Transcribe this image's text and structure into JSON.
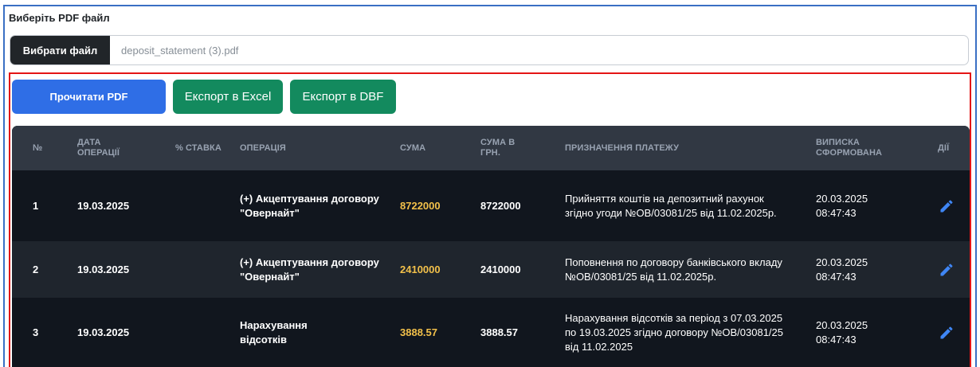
{
  "file_section": {
    "label": "Виберіть PDF файл",
    "choose_button": "Вибрати файл",
    "file_name": "deposit_statement (3).pdf"
  },
  "toolbar": {
    "read_pdf": "Прочитати PDF",
    "export_excel": "Експорт в Excel",
    "export_dbf": "Експорт в DBF"
  },
  "colors": {
    "primary": "#2f6ee6",
    "success": "#138a5e",
    "table_bg": "#11161e",
    "amount": "#f2c04a",
    "highlight_border": "#e41515"
  },
  "table": {
    "headers": {
      "num": "№",
      "date": "ДАТА ОПЕРАЦІЇ",
      "rate": "% СТАВКА",
      "operation": "ОПЕРАЦІЯ",
      "sum": "СУМА",
      "sum_uah": "СУМА В ГРН.",
      "purpose": "ПРИЗНАЧЕННЯ ПЛАТЕЖУ",
      "statement": "ВИПИСКА СФОРМОВАНА",
      "actions": "ДІЇ"
    },
    "rows": [
      {
        "num": "1",
        "date": "19.03.2025",
        "rate": "",
        "operation": "(+) Акцептування договору \"Овернайт\"",
        "sum": "8722000",
        "sum_uah": "8722000",
        "purpose": "Прийняття коштів на депозитний рахунок згідно угоди №OB/03081/25 від 11.02.2025р.",
        "statement": "20.03.2025 08:47:43",
        "action_icon": "pencil-icon"
      },
      {
        "num": "2",
        "date": "19.03.2025",
        "rate": "",
        "operation": "(+) Акцептування договору \"Овернайт\"",
        "sum": "2410000",
        "sum_uah": "2410000",
        "purpose": "Поповнення по договору банківського вкладу №OB/03081/25 від 11.02.2025р.",
        "statement": "20.03.2025 08:47:43",
        "action_icon": "pencil-icon"
      },
      {
        "num": "3",
        "date": "19.03.2025",
        "rate": "",
        "operation": "Нарахування відсотків",
        "sum": "3888.57",
        "sum_uah": "3888.57",
        "purpose": "Нарахування відсотків за період з 07.03.2025 по 19.03.2025 згідно договору №OB/03081/25 від 11.02.2025",
        "statement": "20.03.2025 08:47:43",
        "action_icon": "pencil-icon"
      }
    ]
  }
}
